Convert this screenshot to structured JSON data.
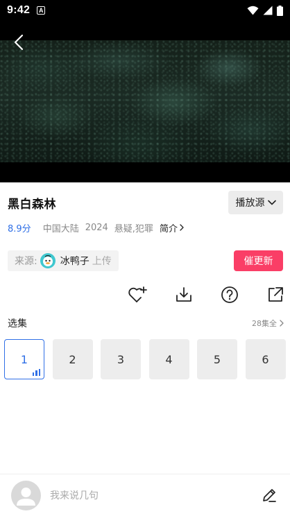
{
  "status_bar": {
    "time": "9:42",
    "notification_glyph": "A"
  },
  "video": {
    "title": "黑白森林",
    "source_button_label": "播放源"
  },
  "meta": {
    "rating": "8.9分",
    "region": "中国大陆",
    "year": "2024",
    "genres": "悬疑,犯罪",
    "intro_label": "简介"
  },
  "uploader": {
    "label": "来源:",
    "name": "冰鸭子",
    "tag": "上传"
  },
  "urge_button_label": "催更新",
  "actions": [
    "favorite-add-icon",
    "download-icon",
    "help-icon",
    "share-icon"
  ],
  "episodes": {
    "title": "选集",
    "total_label": "28集全",
    "items": [
      {
        "label": "1",
        "active": true
      },
      {
        "label": "2",
        "active": false
      },
      {
        "label": "3",
        "active": false
      },
      {
        "label": "4",
        "active": false
      },
      {
        "label": "5",
        "active": false
      },
      {
        "label": "6",
        "active": false
      }
    ]
  },
  "comment": {
    "placeholder": "我来说几句"
  },
  "colors": {
    "accent_blue": "#2f6fe6",
    "urge_red": "#fa3e66"
  }
}
